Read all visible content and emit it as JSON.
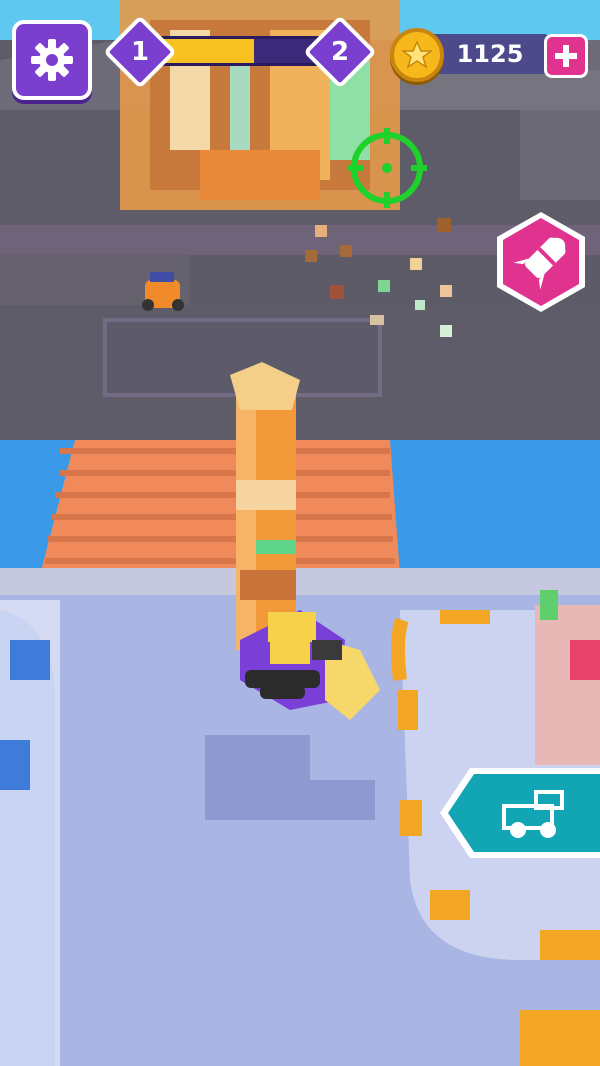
{
  "hud": {
    "level_current": "1",
    "level_next": "2",
    "level_progress": 0.6,
    "coins": "1125"
  },
  "icons": {
    "settings": "gear-icon",
    "coin": "star-coin-icon",
    "add": "plus-icon",
    "missile": "missile-icon",
    "vehicle": "truck-icon",
    "target": "crosshair-icon"
  },
  "colors": {
    "hud_purple": "#7b3fd0",
    "progress_yellow": "#f7c21f",
    "coin_gold": "#f6b81a",
    "add_pink": "#e0338f",
    "missile_pink": "#e0338f",
    "vehicle_teal": "#12a6b5",
    "crosshair_green": "#1fd12b"
  }
}
